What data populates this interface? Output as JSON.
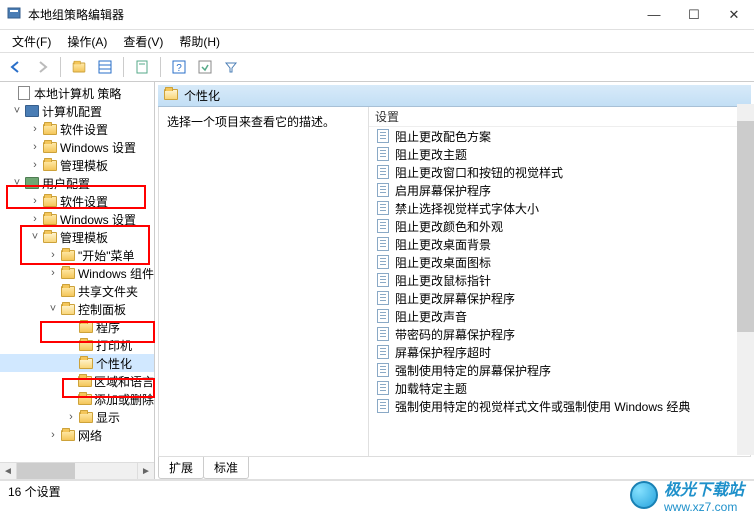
{
  "window": {
    "title": "本地组策略编辑器"
  },
  "menu": {
    "file": "文件(F)",
    "action": "操作(A)",
    "view": "查看(V)",
    "help": "帮助(H)"
  },
  "tree": {
    "root": "本地计算机 策略",
    "computer_config": "计算机配置",
    "cc_software": "软件设置",
    "cc_windows": "Windows 设置",
    "cc_admin": "管理模板",
    "user_config": "用户配置",
    "uc_software": "软件设置",
    "uc_windows": "Windows 设置",
    "uc_admin": "管理模板",
    "start_menu": "\"开始\"菜单",
    "windows_comp": "Windows 组件",
    "shared_folders": "共享文件夹",
    "control_panel": "控制面板",
    "programs": "程序",
    "printers": "打印机",
    "personalization": "个性化",
    "region_lang": "区域和语言",
    "add_remove": "添加或删除",
    "display": "显示",
    "network": "网络"
  },
  "content": {
    "breadcrumb": "个性化",
    "description": "选择一个项目来查看它的描述。",
    "settings_header": "设置",
    "settings": [
      "阻止更改配色方案",
      "阻止更改主题",
      "阻止更改窗口和按钮的视觉样式",
      "启用屏幕保护程序",
      "禁止选择视觉样式字体大小",
      "阻止更改颜色和外观",
      "阻止更改桌面背景",
      "阻止更改桌面图标",
      "阻止更改鼠标指针",
      "阻止更改屏幕保护程序",
      "阻止更改声音",
      "带密码的屏幕保护程序",
      "屏幕保护程序超时",
      "强制使用特定的屏幕保护程序",
      "加载特定主题",
      "强制使用特定的视觉样式文件或强制使用 Windows 经典"
    ]
  },
  "tabs": {
    "extended": "扩展",
    "standard": "标准"
  },
  "status": "16 个设置",
  "watermark": {
    "name": "极光下载站",
    "url": "www.xz7.com"
  }
}
